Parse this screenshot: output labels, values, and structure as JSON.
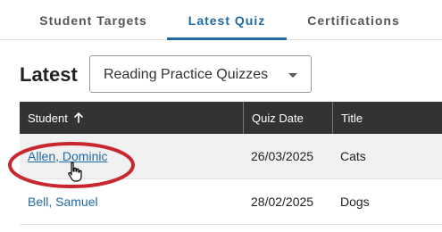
{
  "tabs": [
    {
      "label": "Student Targets"
    },
    {
      "label": "Latest Quiz"
    },
    {
      "label": "Certifications"
    }
  ],
  "active_tab": "Latest Quiz",
  "header": {
    "title": "Latest",
    "quiz_type_select": {
      "value": "Reading Practice Quizzes"
    }
  },
  "table": {
    "columns": [
      {
        "label": "Student",
        "sort": "ascending"
      },
      {
        "label": "Quiz Date"
      },
      {
        "label": "Title"
      }
    ],
    "rows": [
      {
        "student": "Allen, Dominic",
        "quiz_date": "26/03/2025",
        "title": "Cats"
      },
      {
        "student": "Bell, Samuel",
        "quiz_date": "28/02/2025",
        "title": "Dogs"
      }
    ]
  },
  "colors": {
    "accent": "#1f6aa5",
    "header_bg": "#333333",
    "highlight_ring": "#c8282d"
  },
  "icons": [
    "sort-ascending-arrow-icon",
    "dropdown-caret-icon",
    "hand-pointer-cursor-icon"
  ]
}
